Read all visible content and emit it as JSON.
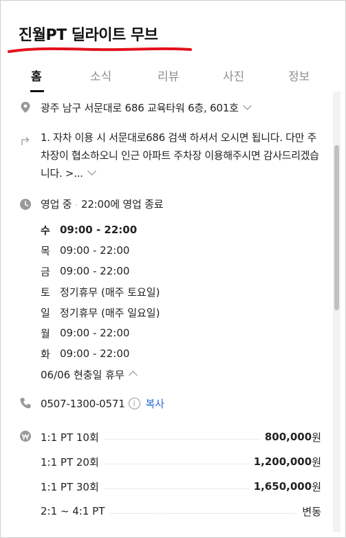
{
  "place": {
    "title": "진월PT 딜라이트 무브"
  },
  "tabs": [
    {
      "label": "홈"
    },
    {
      "label": "소식"
    },
    {
      "label": "리뷰"
    },
    {
      "label": "사진"
    },
    {
      "label": "정보"
    }
  ],
  "address": "광주 남구 서문대로 686 교육타워 6층, 601호",
  "directions": "1. 자차 이용 시 서문대로686 검색 하셔서 오시면 됩니다. 다만 주차장이 협소하오니 인근 아파트 주차장 이용해주시면 감사드리겠습니다. >...",
  "business": {
    "status": "영업 중",
    "separator": "·",
    "closing": "22:00에 영업 종료",
    "hours": [
      {
        "day": "수",
        "time": "09:00 - 22:00"
      },
      {
        "day": "목",
        "time": "09:00 - 22:00"
      },
      {
        "day": "금",
        "time": "09:00 - 22:00"
      },
      {
        "day": "토",
        "time": "정기휴무 (매주 토요일)"
      },
      {
        "day": "일",
        "time": "정기휴무 (매주 일요일)"
      },
      {
        "day": "월",
        "time": "09:00 - 22:00"
      },
      {
        "day": "화",
        "time": "09:00 - 22:00"
      }
    ],
    "holiday_note": "06/06 현충일 휴무"
  },
  "phone": {
    "number": "0507-1300-0571",
    "info_glyph": "i",
    "copy_label": "복사"
  },
  "prices": [
    {
      "name": "1:1 PT 10회",
      "value": "800,000",
      "unit": "원"
    },
    {
      "name": "1:1 PT 20회",
      "value": "1,200,000",
      "unit": "원"
    },
    {
      "name": "1:1 PT 30회",
      "value": "1,650,000",
      "unit": "원"
    },
    {
      "name": "2:1 ~ 4:1 PT",
      "value": "",
      "unit": "변동"
    }
  ],
  "colors": {
    "accent_blue": "#2d6fd6",
    "annotation_red": "#e3101c",
    "icon_gray": "#999999",
    "inactive_tab": "#8e8e8e"
  },
  "icons": {
    "address": "map-pin-icon",
    "directions": "turn-arrow-icon",
    "hours": "clock-icon",
    "phone": "phone-icon",
    "price": "won-coin-icon"
  }
}
